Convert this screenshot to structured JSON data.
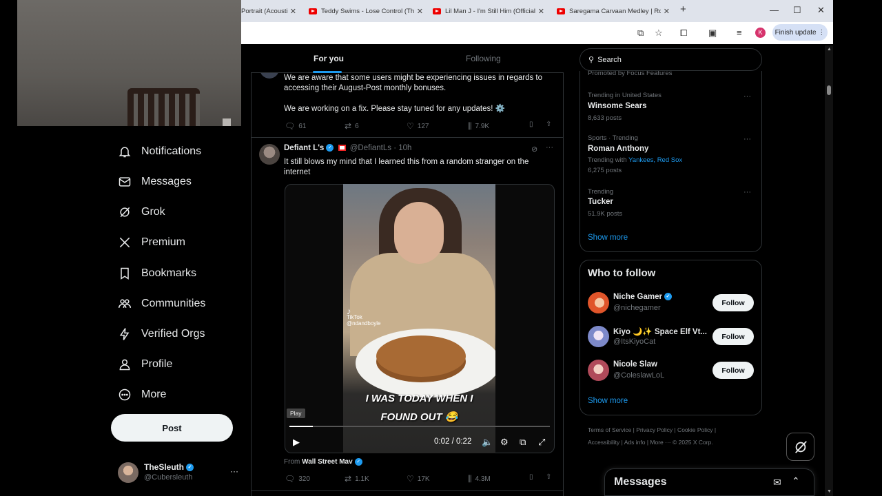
{
  "browser": {
    "tabs": [
      {
        "title": "Portrait (Acoustic",
        "icon": "youtube-icon"
      },
      {
        "title": "Teddy Swims - Lose Control (Th",
        "icon": "youtube-icon"
      },
      {
        "title": "Lil Man J - I'm Still Him (Official",
        "icon": "youtube-icon"
      },
      {
        "title": "Saregama Carvaan Medley | Ro",
        "icon": "youtube-icon"
      }
    ],
    "avatar_letter": "K",
    "finish_update": "Finish update"
  },
  "nav": {
    "items": [
      {
        "label": "Notifications",
        "icon": "bell-icon"
      },
      {
        "label": "Messages",
        "icon": "envelope-icon"
      },
      {
        "label": "Grok",
        "icon": "grok-icon"
      },
      {
        "label": "Premium",
        "icon": "x-logo-icon"
      },
      {
        "label": "Bookmarks",
        "icon": "bookmark-icon"
      },
      {
        "label": "Communities",
        "icon": "people-icon"
      },
      {
        "label": "Verified Orgs",
        "icon": "lightning-icon"
      },
      {
        "label": "Profile",
        "icon": "person-icon"
      },
      {
        "label": "More",
        "icon": "more-circle-icon"
      }
    ],
    "post_label": "Post",
    "account": {
      "name": "TheSleuth",
      "handle": "@Cubersleuth",
      "more": "···"
    }
  },
  "feed": {
    "tabs": [
      {
        "label": "For you",
        "active": true
      },
      {
        "label": "Following",
        "active": false
      }
    ],
    "tweet1": {
      "text1": "We are aware that some users might be experiencing issues in regards to accessing their August-Post monthly bonuses.",
      "text2": "We are working on a fix. Please stay tuned for any updates! ⚙️",
      "replies": "61",
      "reposts": "6",
      "likes": "127",
      "views": "7.9K"
    },
    "tweet2": {
      "author": "Defiant L's",
      "handle": "@DefiantLs",
      "time": "· 10h",
      "text": "It still blows my mind that I learned this from a random stranger on the internet",
      "video": {
        "caption_line1": "I WAS TODAY WHEN I",
        "caption_line2": "FOUND OUT 😂",
        "watermark": "TikTok",
        "watermark_handle": "@ndandboyle",
        "tooltip": "Play",
        "time": "0:02 / 0:22",
        "progress": 0.09
      },
      "from_label": "From",
      "from_source": "Wall Street Mav",
      "replies": "320",
      "reposts": "1.1K",
      "likes": "17K",
      "views": "4.3M"
    }
  },
  "sidebar": {
    "search_placeholder": "Search",
    "promoted": "Promoted by Focus Features",
    "trends": [
      {
        "meta": "Trending in United States",
        "name": "Winsome Sears",
        "count": "8,633 posts"
      },
      {
        "meta": "Sports · Trending",
        "name": "Roman Anthony",
        "with_label": "Trending with",
        "with_links": "Yankees, Red Sox",
        "count": "6,275 posts"
      },
      {
        "meta": "Trending",
        "name": "Tucker",
        "count": "51.9K posts"
      }
    ],
    "trends_show_more": "Show more",
    "who_to_follow": {
      "title": "Who to follow",
      "accounts": [
        {
          "name": "Niche Gamer",
          "handle": "@nichegamer",
          "button": "Follow"
        },
        {
          "name": "Kiyo 🌙✨ Space Elf Vt...",
          "handle": "@ItsKiyoCat",
          "button": "Follow"
        },
        {
          "name": "Nicole Slaw",
          "handle": "@ColeslawLoL",
          "button": "Follow"
        }
      ],
      "show_more": "Show more"
    },
    "footer_line1": "Terms of Service  |  Privacy Policy  |  Cookie Policy  |",
    "footer_line2": "Accessibility  |  Ads info  |  More ···  © 2025 X Corp.",
    "messages_title": "Messages"
  },
  "colors": {
    "accent": "#1d9bf0",
    "background": "#000000",
    "text": "#e7e9ea",
    "muted": "#71767b"
  }
}
